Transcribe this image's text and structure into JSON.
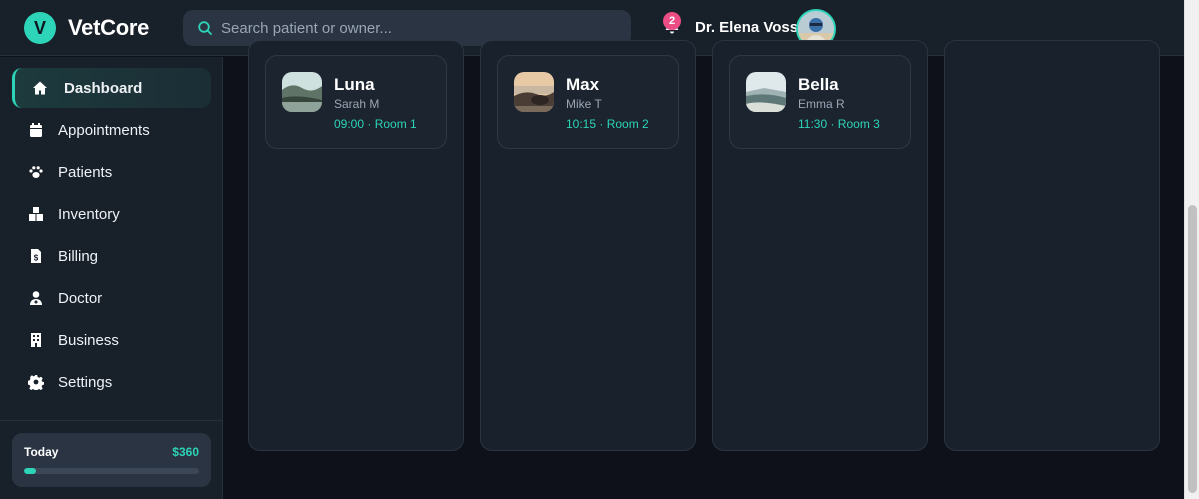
{
  "brand": {
    "logo_letter": "V",
    "name": "VetCore"
  },
  "search": {
    "placeholder": "Search patient or owner...",
    "value": "",
    "icon": "search-icon"
  },
  "notifications": {
    "count": "2",
    "icon": "bell-icon"
  },
  "user": {
    "name": "Dr. Elena Voss",
    "avatar": "user-avatar"
  },
  "sidebar": {
    "items": [
      {
        "label": "Dashboard",
        "icon": "home-icon",
        "active": true
      },
      {
        "label": "Appointments",
        "icon": "calendar-icon"
      },
      {
        "label": "Patients",
        "icon": "paw-icon"
      },
      {
        "label": "Inventory",
        "icon": "boxes-icon"
      },
      {
        "label": "Billing",
        "icon": "invoice-icon"
      },
      {
        "label": "Doctor",
        "icon": "doctor-icon"
      },
      {
        "label": "Business",
        "icon": "building-icon"
      },
      {
        "label": "Settings",
        "icon": "gear-icon"
      }
    ],
    "today": {
      "label": "Today",
      "amount": "$360",
      "progress": 0.07
    }
  },
  "board": {
    "columns": [
      {
        "cards": [
          {
            "name": "Luna",
            "owner": "Sarah M",
            "slot": "09:00 · Room 1"
          }
        ]
      },
      {
        "cards": [
          {
            "name": "Max",
            "owner": "Mike T",
            "slot": "10:15 · Room 2"
          }
        ]
      },
      {
        "cards": [
          {
            "name": "Bella",
            "owner": "Emma R",
            "slot": "11:30 · Room 3"
          }
        ]
      },
      {
        "cards": []
      }
    ]
  },
  "colors": {
    "accent": "#2dd4b7",
    "badge": "#ec4d84",
    "panel": "#18202a",
    "background": "#0e1119"
  }
}
